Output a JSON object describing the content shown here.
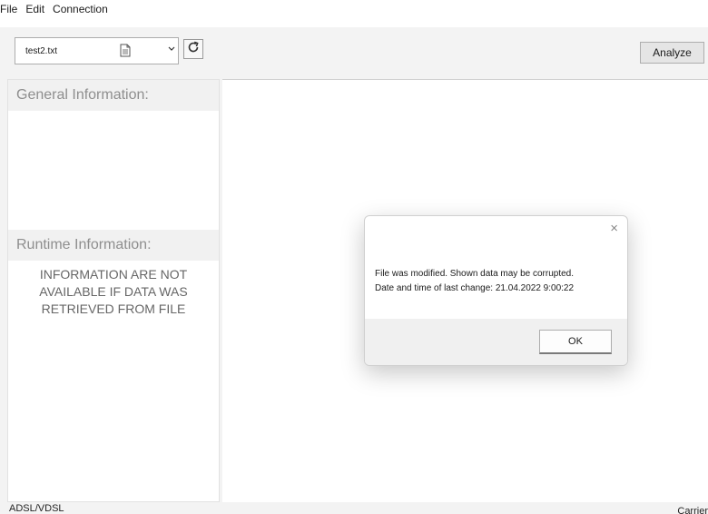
{
  "menu": {
    "items": [
      "File",
      "Edit",
      "Connection"
    ]
  },
  "toolbar": {
    "file_select": "test2.txt",
    "analyze_label": "Analyze"
  },
  "left_panel": {
    "general_header": "General Information:",
    "runtime_header": "Runtime Information:",
    "notice_lines": [
      "INFORMATION ARE NOT",
      "AVAILABLE IF DATA WAS",
      "RETRIEVED FROM FILE"
    ]
  },
  "status_bar": {
    "left": "ADSL/VDSL",
    "right": "Carrier"
  },
  "dialog": {
    "close_glyph": "×",
    "message_lines": [
      "File was modified. Shown data may be corrupted.",
      "Date and time of last change: 21.04.2022 9:00:22"
    ],
    "ok_label": "OK"
  },
  "icons": {
    "file": "document-icon",
    "refresh": "refresh-icon",
    "chevron": "chevron-down-icon",
    "close": "close-icon"
  }
}
